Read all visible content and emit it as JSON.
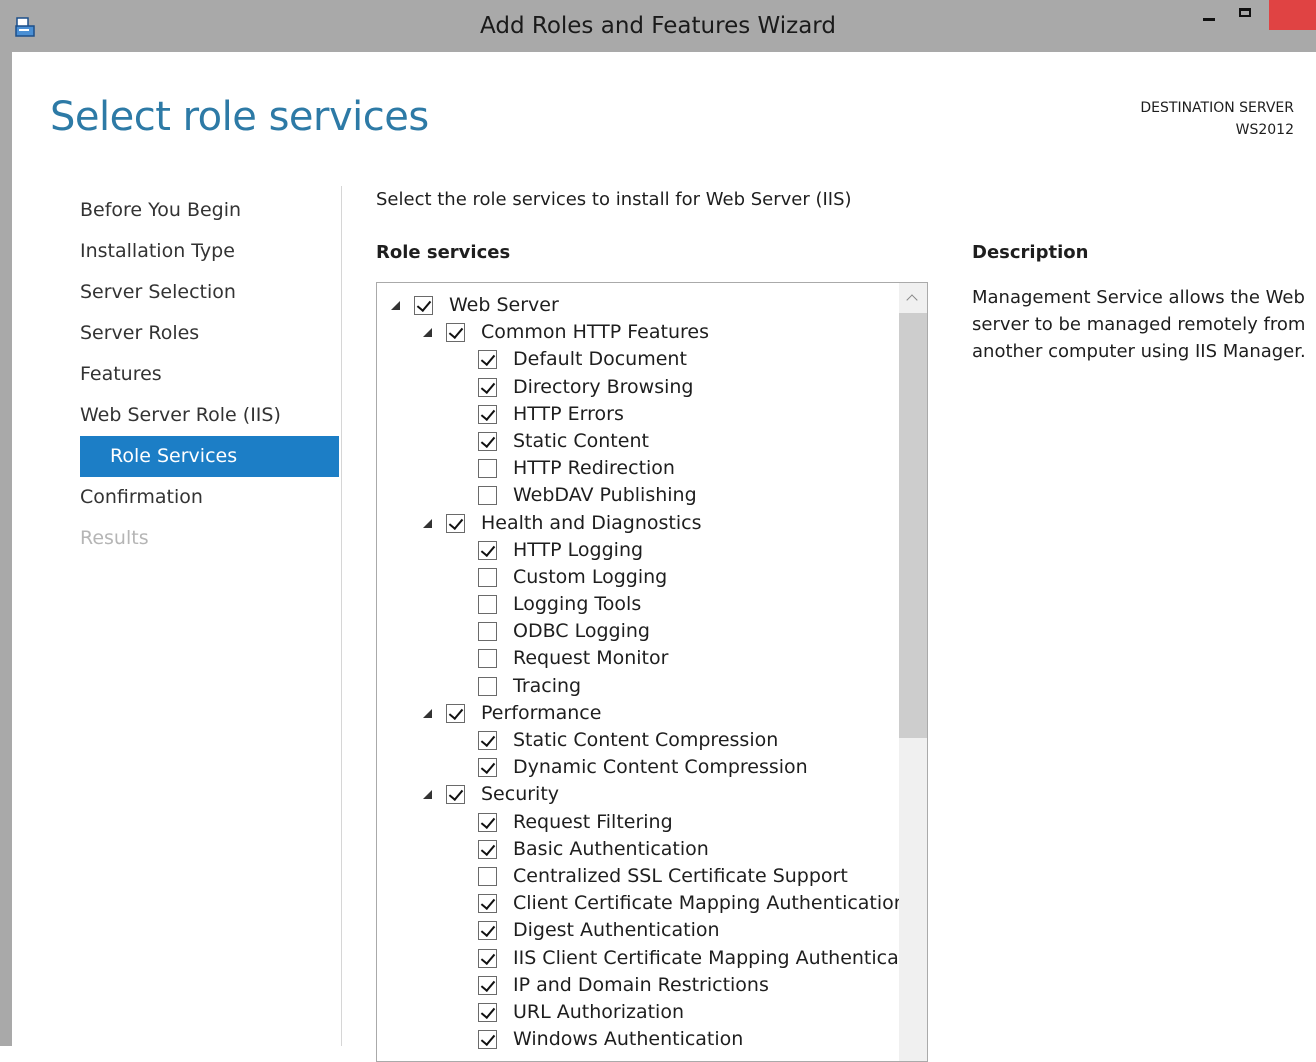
{
  "window": {
    "title": "Add Roles and Features Wizard",
    "accent_color": "#1c7ec6",
    "title_color": "#2d7aa6",
    "close_color": "#e04343"
  },
  "header": {
    "page_title": "Select role services",
    "destination_label": "DESTINATION SERVER",
    "destination_server": "WS2012"
  },
  "nav": {
    "items": [
      {
        "label": "Before You Begin",
        "state": "normal"
      },
      {
        "label": "Installation Type",
        "state": "normal"
      },
      {
        "label": "Server Selection",
        "state": "normal"
      },
      {
        "label": "Server Roles",
        "state": "normal"
      },
      {
        "label": "Features",
        "state": "normal"
      },
      {
        "label": "Web Server Role (IIS)",
        "state": "normal"
      },
      {
        "label": "Role Services",
        "state": "active"
      },
      {
        "label": "Confirmation",
        "state": "normal"
      },
      {
        "label": "Results",
        "state": "disabled"
      }
    ]
  },
  "main": {
    "intro": "Select the role services to install for Web Server (IIS)",
    "role_services_label": "Role services",
    "description_label": "Description",
    "description_text": "Management Service allows the Web server to be managed remotely from another computer using IIS Manager."
  },
  "tree": [
    {
      "label": "Web Server",
      "level": 0,
      "expandable": true,
      "checked": true
    },
    {
      "label": "Common HTTP Features",
      "level": 1,
      "expandable": true,
      "checked": true
    },
    {
      "label": "Default Document",
      "level": 2,
      "expandable": false,
      "checked": true
    },
    {
      "label": "Directory Browsing",
      "level": 2,
      "expandable": false,
      "checked": true
    },
    {
      "label": "HTTP Errors",
      "level": 2,
      "expandable": false,
      "checked": true
    },
    {
      "label": "Static Content",
      "level": 2,
      "expandable": false,
      "checked": true
    },
    {
      "label": "HTTP Redirection",
      "level": 2,
      "expandable": false,
      "checked": false
    },
    {
      "label": "WebDAV Publishing",
      "level": 2,
      "expandable": false,
      "checked": false
    },
    {
      "label": "Health and Diagnostics",
      "level": 1,
      "expandable": true,
      "checked": true
    },
    {
      "label": "HTTP Logging",
      "level": 2,
      "expandable": false,
      "checked": true
    },
    {
      "label": "Custom Logging",
      "level": 2,
      "expandable": false,
      "checked": false
    },
    {
      "label": "Logging Tools",
      "level": 2,
      "expandable": false,
      "checked": false
    },
    {
      "label": "ODBC Logging",
      "level": 2,
      "expandable": false,
      "checked": false
    },
    {
      "label": "Request Monitor",
      "level": 2,
      "expandable": false,
      "checked": false
    },
    {
      "label": "Tracing",
      "level": 2,
      "expandable": false,
      "checked": false
    },
    {
      "label": "Performance",
      "level": 1,
      "expandable": true,
      "checked": true
    },
    {
      "label": "Static Content Compression",
      "level": 2,
      "expandable": false,
      "checked": true
    },
    {
      "label": "Dynamic Content Compression",
      "level": 2,
      "expandable": false,
      "checked": true
    },
    {
      "label": "Security",
      "level": 1,
      "expandable": true,
      "checked": true
    },
    {
      "label": "Request Filtering",
      "level": 2,
      "expandable": false,
      "checked": true
    },
    {
      "label": "Basic Authentication",
      "level": 2,
      "expandable": false,
      "checked": true
    },
    {
      "label": "Centralized SSL Certificate Support",
      "level": 2,
      "expandable": false,
      "checked": false
    },
    {
      "label": "Client Certificate Mapping Authentication",
      "level": 2,
      "expandable": false,
      "checked": true
    },
    {
      "label": "Digest Authentication",
      "level": 2,
      "expandable": false,
      "checked": true
    },
    {
      "label": "IIS Client Certificate Mapping Authenticatic",
      "level": 2,
      "expandable": false,
      "checked": true
    },
    {
      "label": "IP and Domain Restrictions",
      "level": 2,
      "expandable": false,
      "checked": true
    },
    {
      "label": "URL Authorization",
      "level": 2,
      "expandable": false,
      "checked": true
    },
    {
      "label": "Windows Authentication",
      "level": 2,
      "expandable": false,
      "checked": true
    }
  ]
}
